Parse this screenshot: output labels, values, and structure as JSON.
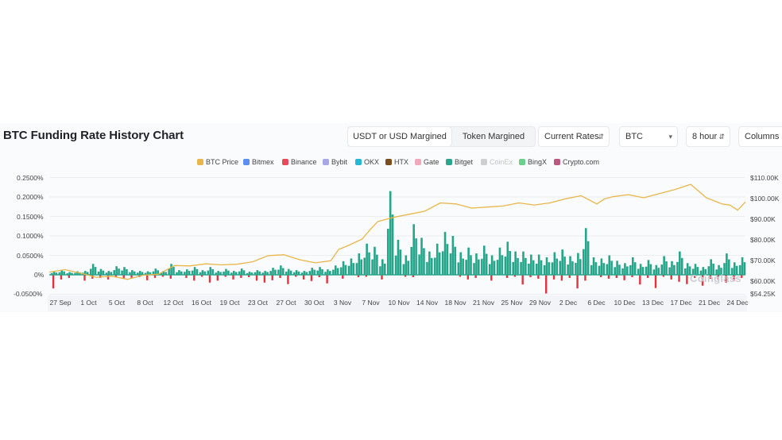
{
  "header": {
    "title": "BTC Funding Rate History Chart",
    "margin_tabs": [
      "USDT or USD Margined",
      "Token Margined"
    ],
    "active_margin_tab": 0,
    "rate_select": "Current Rates",
    "coin_select": "BTC",
    "interval_select": "8 hour",
    "view_select": "Columns"
  },
  "colors": {
    "btc_price": "#e8b64a",
    "bitmex": "#5b8ef0",
    "binance": "#e54b5a",
    "bybit": "#a9a6e6",
    "okx": "#28b6d8",
    "htx": "#7a4d1e",
    "gate": "#f0a9bb",
    "bitget": "#2ba58c",
    "coinex": "#cfcfcf",
    "bingx": "#6ccf8c",
    "cryptocom": "#b9597f",
    "negative_bar": "#e0353f",
    "positive_bar": "#25a58a"
  },
  "watermark": "Coinglass",
  "chart_data": {
    "type": "bar",
    "title": "BTC Funding Rate History Chart",
    "legend": [
      {
        "name": "BTC Price",
        "color": "#e8b64a",
        "active": true
      },
      {
        "name": "Bitmex",
        "color": "#5b8ef0",
        "active": true
      },
      {
        "name": "Binance",
        "color": "#e54b5a",
        "active": true
      },
      {
        "name": "Bybit",
        "color": "#a9a6e6",
        "active": true
      },
      {
        "name": "OKX",
        "color": "#28b6d8",
        "active": true
      },
      {
        "name": "HTX",
        "color": "#7a4d1e",
        "active": true
      },
      {
        "name": "Gate",
        "color": "#f0a9bb",
        "active": true
      },
      {
        "name": "Bitget",
        "color": "#2ba58c",
        "active": true
      },
      {
        "name": "CoinEx",
        "color": "#cfcfcf",
        "active": false
      },
      {
        "name": "BingX",
        "color": "#6ccf8c",
        "active": true
      },
      {
        "name": "Crypto.com",
        "color": "#b9597f",
        "active": true
      }
    ],
    "legend_position": "top-center",
    "x_tick_labels": [
      "27 Sep",
      "1 Oct",
      "5 Oct",
      "8 Oct",
      "12 Oct",
      "16 Oct",
      "19 Oct",
      "23 Oct",
      "27 Oct",
      "30 Oct",
      "3 Nov",
      "7 Nov",
      "10 Nov",
      "14 Nov",
      "18 Nov",
      "21 Nov",
      "25 Nov",
      "29 Nov",
      "2 Dec",
      "6 Dec",
      "10 Dec",
      "13 Dec",
      "17 Dec",
      "21 Dec",
      "24 Dec"
    ],
    "y_left": {
      "label": "",
      "tick_labels": [
        "0.2500%",
        "0.2000%",
        "0.1500%",
        "0.1000%",
        "0.0500%",
        "0%",
        "-0.0500%"
      ],
      "ticks": [
        0.25,
        0.2,
        0.15,
        0.1,
        0.05,
        0,
        -0.05
      ],
      "range": [
        -0.05,
        0.25
      ]
    },
    "y_right": {
      "label": "",
      "tick_labels": [
        "$110.00K",
        "$100.00K",
        "$90.00K",
        "$80.00K",
        "$70.00K",
        "$60.00K",
        "$54.25K"
      ],
      "ticks": [
        110000,
        100000,
        90000,
        80000,
        70000,
        60000,
        54250
      ],
      "range": [
        54250,
        110000
      ]
    },
    "grid": true,
    "btc_price_series": {
      "name": "BTC Price",
      "x_days": [
        0,
        2,
        4,
        6,
        8,
        10,
        12,
        14,
        16,
        18,
        20,
        22,
        24,
        26,
        28,
        30,
        32,
        34,
        36,
        37,
        38,
        40,
        41,
        42,
        44,
        46,
        48,
        50,
        52,
        54,
        56,
        58,
        60,
        62,
        64,
        66,
        68,
        70,
        71,
        72,
        74,
        76,
        78,
        80,
        82,
        84,
        86,
        87,
        88,
        89
      ],
      "values": [
        64000,
        65200,
        63500,
        61500,
        62000,
        60500,
        62500,
        63000,
        67200,
        67000,
        68000,
        67500,
        67800,
        69000,
        72000,
        72400,
        70000,
        68500,
        69500,
        75000,
        76500,
        80000,
        84500,
        88500,
        90500,
        92000,
        93500,
        97500,
        97000,
        95000,
        95500,
        96000,
        97500,
        96500,
        97500,
        99500,
        101000,
        97000,
        99500,
        100500,
        101500,
        100000,
        102000,
        104000,
        106500,
        100000,
        97000,
        96500,
        94000,
        98000
      ]
    },
    "funding_rate_bars": {
      "name": "Funding Rate (all exchanges, % per 8h)",
      "x_days": [
        0.5,
        1.5,
        2.5,
        3.5,
        4.5,
        5.5,
        6.5,
        7.5,
        8.5,
        9.5,
        10.5,
        11.5,
        12.5,
        13.5,
        14.5,
        15.5,
        16.5,
        17.5,
        18.5,
        19.5,
        20.5,
        21.5,
        22.5,
        23.5,
        24.5,
        25.5,
        26.5,
        27.5,
        28.5,
        29.5,
        30.5,
        31.5,
        32.5,
        33.5,
        34.5,
        35.5,
        36.5,
        37.5,
        38.5,
        39.5,
        40.5,
        41.5,
        42.5,
        43.5,
        44.5,
        45.5,
        46.5,
        47.5,
        48.5,
        49.5,
        50.5,
        51.5,
        52.5,
        53.5,
        54.5,
        55.5,
        56.5,
        57.5,
        58.5,
        59.5,
        60.5,
        61.5,
        62.5,
        63.5,
        64.5,
        65.5,
        66.5,
        67.5,
        68.5,
        69.5,
        70.5,
        71.5,
        72.5,
        73.5,
        74.5,
        75.5,
        76.5,
        77.5,
        78.5,
        79.5,
        80.5,
        81.5,
        82.5,
        83.5,
        84.5,
        85.5,
        86.5,
        87.5,
        88.5
      ],
      "max_values": [
        0.008,
        0.012,
        0.007,
        0.009,
        0.01,
        0.028,
        0.015,
        0.01,
        0.022,
        0.02,
        0.012,
        0.01,
        0.009,
        0.016,
        0.01,
        0.028,
        0.012,
        0.014,
        0.02,
        0.012,
        0.02,
        0.01,
        0.015,
        0.01,
        0.016,
        0.008,
        0.012,
        0.01,
        0.018,
        0.024,
        0.015,
        0.012,
        0.01,
        0.018,
        0.02,
        0.014,
        0.024,
        0.035,
        0.042,
        0.055,
        0.08,
        0.072,
        0.04,
        0.215,
        0.09,
        0.05,
        0.13,
        0.095,
        0.06,
        0.08,
        0.11,
        0.1,
        0.058,
        0.07,
        0.055,
        0.075,
        0.05,
        0.07,
        0.085,
        0.06,
        0.06,
        0.052,
        0.052,
        0.045,
        0.058,
        0.065,
        0.048,
        0.056,
        0.12,
        0.045,
        0.042,
        0.05,
        0.036,
        0.03,
        0.045,
        0.028,
        0.038,
        0.025,
        0.048,
        0.035,
        0.06,
        0.03,
        0.028,
        0.02,
        0.04,
        0.025,
        0.055,
        0.032,
        0.045
      ],
      "min_values": [
        -0.035,
        -0.012,
        -0.008,
        -0.004,
        -0.015,
        -0.01,
        -0.008,
        -0.012,
        -0.006,
        -0.01,
        -0.008,
        -0.006,
        -0.014,
        -0.008,
        -0.005,
        -0.01,
        -0.004,
        -0.008,
        -0.015,
        -0.005,
        -0.02,
        -0.015,
        -0.005,
        -0.012,
        -0.008,
        -0.006,
        -0.015,
        -0.02,
        -0.014,
        -0.008,
        -0.024,
        -0.005,
        -0.012,
        -0.016,
        -0.006,
        -0.022,
        -0.004,
        -0.01,
        -0.004,
        -0.006,
        -0.005,
        -0.003,
        -0.012,
        -0.004,
        -0.003,
        -0.005,
        -0.006,
        -0.002,
        -0.004,
        -0.003,
        -0.004,
        -0.002,
        -0.005,
        -0.012,
        -0.008,
        -0.004,
        -0.015,
        -0.004,
        -0.008,
        -0.005,
        -0.025,
        -0.006,
        -0.01,
        -0.048,
        -0.012,
        -0.015,
        -0.008,
        -0.035,
        -0.015,
        -0.004,
        -0.006,
        -0.01,
        -0.008,
        -0.014,
        -0.006,
        -0.025,
        -0.008,
        -0.034,
        -0.005,
        -0.012,
        -0.018,
        -0.024,
        -0.008,
        -0.028,
        -0.01,
        -0.012,
        -0.02,
        -0.016,
        -0.008
      ]
    }
  }
}
